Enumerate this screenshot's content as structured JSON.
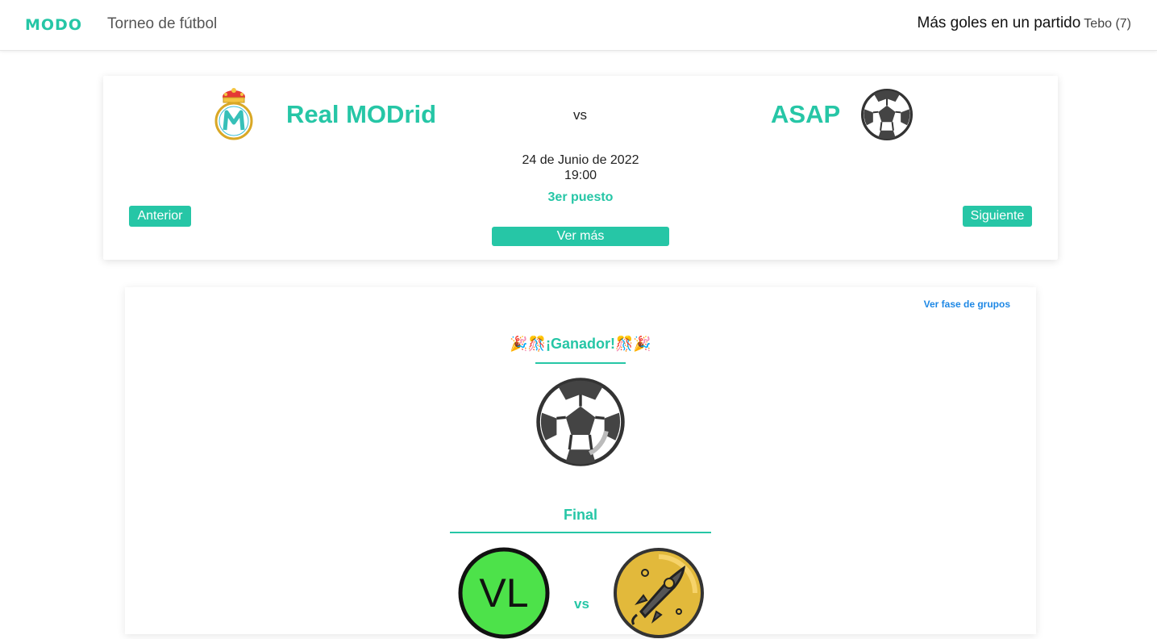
{
  "header": {
    "logo": "MODO",
    "title": "Torneo de fútbol",
    "top_scorer_label": "Más goles en un partido",
    "top_scorer_value": "Tebo (7)"
  },
  "match": {
    "home_team": "Real MODrid",
    "away_team": "ASAP",
    "vs": "vs",
    "date": "24 de Junio de 2022",
    "time": "19:00",
    "round": "3er puesto",
    "prev_label": "Anterior",
    "next_label": "Siguiente",
    "more_label": "Ver más"
  },
  "bracket": {
    "groups_link": "Ver fase de grupos",
    "winner_title": "🎉🎊¡Ganador!🎊🎉",
    "final_title": "Final",
    "final_vs": "vs",
    "final_home_badge_text": "VL"
  },
  "colors": {
    "accent": "#26c6a6",
    "link": "#1e88e5",
    "vl_green": "#4de24a",
    "rocket_gold": "#e2b93b"
  }
}
